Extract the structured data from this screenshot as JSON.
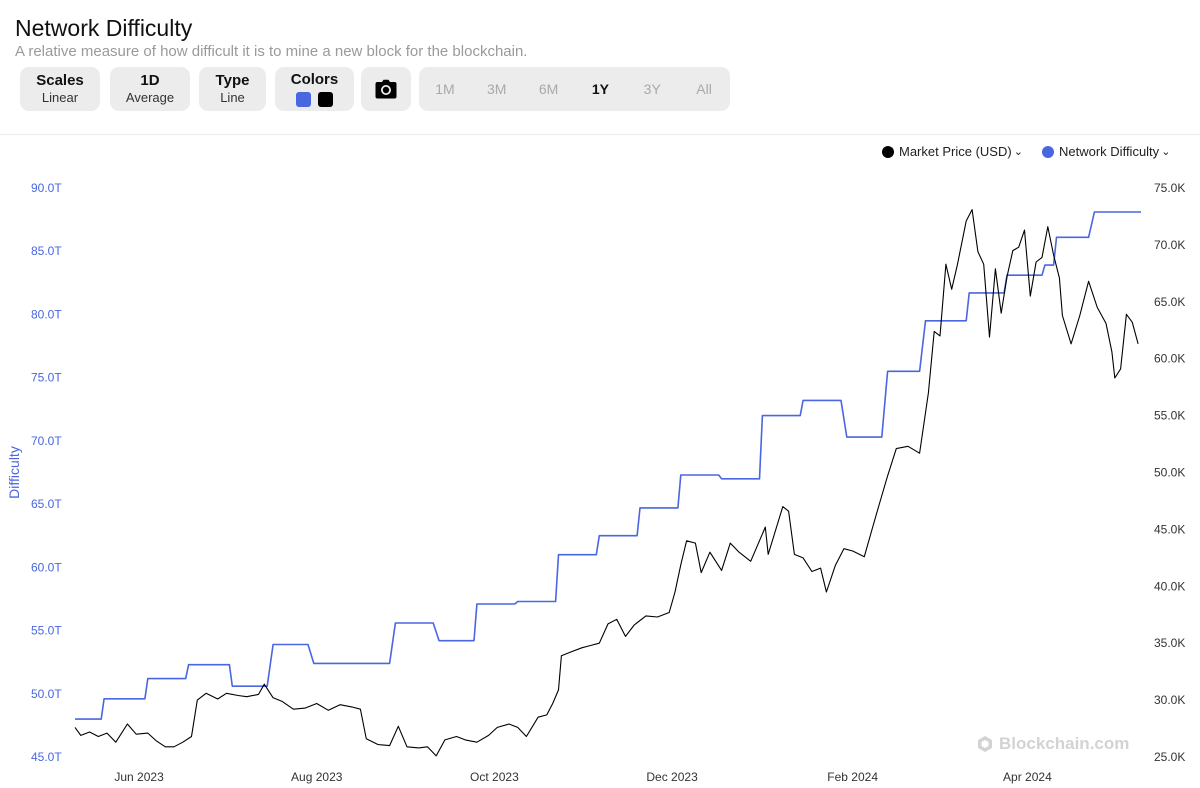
{
  "header": {
    "title": "Network Difficulty",
    "subtitle": "A relative measure of how difficult it is to mine a new block for the blockchain."
  },
  "controls": {
    "scales": {
      "label": "Scales",
      "value": "Linear"
    },
    "average": {
      "label": "1D",
      "value": "Average"
    },
    "type": {
      "label": "Type",
      "value": "Line"
    },
    "colors": {
      "label": "Colors",
      "swatch1": "#4a66e0",
      "swatch2": "#000000"
    },
    "camera_icon": "camera-icon"
  },
  "ranges": [
    {
      "label": "1M",
      "active": false
    },
    {
      "label": "3M",
      "active": false
    },
    {
      "label": "6M",
      "active": false
    },
    {
      "label": "1Y",
      "active": true
    },
    {
      "label": "3Y",
      "active": false
    },
    {
      "label": "All",
      "active": false
    }
  ],
  "legend": {
    "price": "Market Price (USD)",
    "difficulty": "Network Difficulty"
  },
  "watermark": "Blockchain.com",
  "chart_data": {
    "type": "line",
    "ylabel_left": "Difficulty",
    "x_ticks": [
      "Jun 2023",
      "Aug 2023",
      "Oct 2023",
      "Dec 2023",
      "Feb 2024",
      "Apr 2024"
    ],
    "x_tick_dates": [
      "2023-06-01",
      "2023-08-01",
      "2023-10-01",
      "2023-12-01",
      "2024-02-01",
      "2024-04-01"
    ],
    "x_range": [
      "2023-05-10",
      "2024-05-10"
    ],
    "left_axis": {
      "min": 45,
      "max": 90,
      "unit": "T",
      "ticks": [
        "45.0T",
        "50.0T",
        "55.0T",
        "60.0T",
        "65.0T",
        "70.0T",
        "75.0T",
        "80.0T",
        "85.0T",
        "90.0T"
      ],
      "color": "#4a66e0"
    },
    "right_axis": {
      "min": 25,
      "max": 75,
      "unit": "K",
      "ticks": [
        "25.0K",
        "30.0K",
        "35.0K",
        "40.0K",
        "45.0K",
        "50.0K",
        "55.0K",
        "60.0K",
        "65.0K",
        "70.0K",
        "75.0K"
      ]
    },
    "series": [
      {
        "name": "Network Difficulty",
        "axis": "left",
        "color": "#4a66e0",
        "points": [
          [
            "2023-05-10",
            48.0
          ],
          [
            "2023-05-19",
            48.0
          ],
          [
            "2023-05-20",
            49.6
          ],
          [
            "2023-06-03",
            49.6
          ],
          [
            "2023-06-04",
            51.2
          ],
          [
            "2023-06-17",
            51.2
          ],
          [
            "2023-06-18",
            52.3
          ],
          [
            "2023-07-02",
            52.3
          ],
          [
            "2023-07-03",
            50.6
          ],
          [
            "2023-07-15",
            50.6
          ],
          [
            "2023-07-17",
            53.9
          ],
          [
            "2023-07-29",
            53.9
          ],
          [
            "2023-07-31",
            52.4
          ],
          [
            "2023-08-26",
            52.4
          ],
          [
            "2023-08-28",
            55.6
          ],
          [
            "2023-09-10",
            55.6
          ],
          [
            "2023-09-12",
            54.2
          ],
          [
            "2023-09-24",
            54.2
          ],
          [
            "2023-09-25",
            57.1
          ],
          [
            "2023-10-08",
            57.1
          ],
          [
            "2023-10-09",
            57.3
          ],
          [
            "2023-10-22",
            57.3
          ],
          [
            "2023-10-23",
            61.0
          ],
          [
            "2023-11-05",
            61.0
          ],
          [
            "2023-11-06",
            62.5
          ],
          [
            "2023-11-19",
            62.5
          ],
          [
            "2023-11-20",
            64.7
          ],
          [
            "2023-12-03",
            64.7
          ],
          [
            "2023-12-04",
            67.3
          ],
          [
            "2023-12-17",
            67.3
          ],
          [
            "2023-12-18",
            67.0
          ],
          [
            "2023-12-31",
            67.0
          ],
          [
            "2024-01-01",
            72.0
          ],
          [
            "2024-01-14",
            72.0
          ],
          [
            "2024-01-15",
            73.2
          ],
          [
            "2024-01-28",
            73.2
          ],
          [
            "2024-01-30",
            70.3
          ],
          [
            "2024-02-11",
            70.3
          ],
          [
            "2024-02-13",
            75.5
          ],
          [
            "2024-02-24",
            75.5
          ],
          [
            "2024-02-26",
            79.5
          ],
          [
            "2024-03-09",
            79.5
          ],
          [
            "2024-03-11",
            79.5
          ],
          [
            "2024-03-12",
            81.7
          ],
          [
            "2024-03-24",
            81.7
          ],
          [
            "2024-03-25",
            83.1
          ],
          [
            "2024-04-05",
            83.1
          ],
          [
            "2024-04-06",
            83.1
          ],
          [
            "2024-04-07",
            83.9
          ],
          [
            "2024-04-10",
            83.9
          ],
          [
            "2024-04-11",
            86.1
          ],
          [
            "2024-04-22",
            86.1
          ],
          [
            "2024-04-24",
            88.1
          ],
          [
            "2024-05-10",
            88.1
          ]
        ]
      },
      {
        "name": "Market Price (USD)",
        "axis": "right",
        "color": "#000000",
        "points": [
          [
            "2023-05-10",
            27.6
          ],
          [
            "2023-05-12",
            26.9
          ],
          [
            "2023-05-15",
            27.2
          ],
          [
            "2023-05-18",
            26.8
          ],
          [
            "2023-05-21",
            27.1
          ],
          [
            "2023-05-24",
            26.3
          ],
          [
            "2023-05-28",
            27.9
          ],
          [
            "2023-05-31",
            27.0
          ],
          [
            "2023-06-04",
            27.1
          ],
          [
            "2023-06-07",
            26.4
          ],
          [
            "2023-06-10",
            25.9
          ],
          [
            "2023-06-13",
            25.9
          ],
          [
            "2023-06-16",
            26.3
          ],
          [
            "2023-06-19",
            26.8
          ],
          [
            "2023-06-21",
            30.0
          ],
          [
            "2023-06-24",
            30.6
          ],
          [
            "2023-06-28",
            30.1
          ],
          [
            "2023-07-01",
            30.6
          ],
          [
            "2023-07-05",
            30.4
          ],
          [
            "2023-07-08",
            30.3
          ],
          [
            "2023-07-12",
            30.5
          ],
          [
            "2023-07-14",
            31.4
          ],
          [
            "2023-07-17",
            30.2
          ],
          [
            "2023-07-20",
            29.9
          ],
          [
            "2023-07-24",
            29.2
          ],
          [
            "2023-07-28",
            29.3
          ],
          [
            "2023-08-01",
            29.7
          ],
          [
            "2023-08-05",
            29.1
          ],
          [
            "2023-08-09",
            29.6
          ],
          [
            "2023-08-13",
            29.4
          ],
          [
            "2023-08-16",
            29.2
          ],
          [
            "2023-08-18",
            26.6
          ],
          [
            "2023-08-22",
            26.1
          ],
          [
            "2023-08-26",
            26.0
          ],
          [
            "2023-08-29",
            27.7
          ],
          [
            "2023-09-01",
            25.9
          ],
          [
            "2023-09-05",
            25.8
          ],
          [
            "2023-09-08",
            25.9
          ],
          [
            "2023-09-11",
            25.1
          ],
          [
            "2023-09-14",
            26.5
          ],
          [
            "2023-09-18",
            26.8
          ],
          [
            "2023-09-21",
            26.5
          ],
          [
            "2023-09-25",
            26.3
          ],
          [
            "2023-09-29",
            26.9
          ],
          [
            "2023-10-02",
            27.6
          ],
          [
            "2023-10-06",
            27.9
          ],
          [
            "2023-10-09",
            27.6
          ],
          [
            "2023-10-12",
            26.8
          ],
          [
            "2023-10-16",
            28.5
          ],
          [
            "2023-10-19",
            28.7
          ],
          [
            "2023-10-21",
            29.7
          ],
          [
            "2023-10-23",
            30.9
          ],
          [
            "2023-10-24",
            33.9
          ],
          [
            "2023-10-27",
            34.2
          ],
          [
            "2023-10-31",
            34.6
          ],
          [
            "2023-11-03",
            34.8
          ],
          [
            "2023-11-06",
            35.0
          ],
          [
            "2023-11-09",
            36.7
          ],
          [
            "2023-11-12",
            37.1
          ],
          [
            "2023-11-15",
            35.6
          ],
          [
            "2023-11-18",
            36.6
          ],
          [
            "2023-11-22",
            37.4
          ],
          [
            "2023-11-26",
            37.3
          ],
          [
            "2023-11-30",
            37.7
          ],
          [
            "2023-12-02",
            39.5
          ],
          [
            "2023-12-04",
            41.9
          ],
          [
            "2023-12-06",
            44.0
          ],
          [
            "2023-12-09",
            43.8
          ],
          [
            "2023-12-11",
            41.2
          ],
          [
            "2023-12-14",
            43.0
          ],
          [
            "2023-12-18",
            41.4
          ],
          [
            "2023-12-21",
            43.8
          ],
          [
            "2023-12-24",
            43.0
          ],
          [
            "2023-12-28",
            42.2
          ],
          [
            "2024-01-02",
            45.2
          ],
          [
            "2024-01-03",
            42.8
          ],
          [
            "2024-01-08",
            47.0
          ],
          [
            "2024-01-10",
            46.6
          ],
          [
            "2024-01-12",
            42.8
          ],
          [
            "2024-01-15",
            42.5
          ],
          [
            "2024-01-18",
            41.3
          ],
          [
            "2024-01-21",
            41.6
          ],
          [
            "2024-01-23",
            39.5
          ],
          [
            "2024-01-26",
            41.8
          ],
          [
            "2024-01-29",
            43.3
          ],
          [
            "2024-02-01",
            43.1
          ],
          [
            "2024-02-05",
            42.6
          ],
          [
            "2024-02-08",
            45.3
          ],
          [
            "2024-02-10",
            47.1
          ],
          [
            "2024-02-13",
            49.7
          ],
          [
            "2024-02-16",
            52.1
          ],
          [
            "2024-02-20",
            52.3
          ],
          [
            "2024-02-24",
            51.7
          ],
          [
            "2024-02-27",
            57.0
          ],
          [
            "2024-02-29",
            62.4
          ],
          [
            "2024-03-02",
            62.0
          ],
          [
            "2024-03-04",
            68.3
          ],
          [
            "2024-03-06",
            66.1
          ],
          [
            "2024-03-08",
            68.3
          ],
          [
            "2024-03-11",
            72.1
          ],
          [
            "2024-03-13",
            73.1
          ],
          [
            "2024-03-15",
            69.4
          ],
          [
            "2024-03-17",
            68.3
          ],
          [
            "2024-03-19",
            61.9
          ],
          [
            "2024-03-21",
            67.9
          ],
          [
            "2024-03-23",
            64.0
          ],
          [
            "2024-03-25",
            67.2
          ],
          [
            "2024-03-27",
            69.5
          ],
          [
            "2024-03-29",
            69.8
          ],
          [
            "2024-03-31",
            71.3
          ],
          [
            "2024-04-02",
            65.5
          ],
          [
            "2024-04-04",
            68.5
          ],
          [
            "2024-04-06",
            68.9
          ],
          [
            "2024-04-08",
            71.6
          ],
          [
            "2024-04-10",
            69.1
          ],
          [
            "2024-04-12",
            67.1
          ],
          [
            "2024-04-13",
            63.8
          ],
          [
            "2024-04-16",
            61.3
          ],
          [
            "2024-04-19",
            63.8
          ],
          [
            "2024-04-22",
            66.8
          ],
          [
            "2024-04-25",
            64.5
          ],
          [
            "2024-04-28",
            63.1
          ],
          [
            "2024-04-30",
            60.6
          ],
          [
            "2024-05-01",
            58.3
          ],
          [
            "2024-05-03",
            59.1
          ],
          [
            "2024-05-05",
            63.9
          ],
          [
            "2024-05-07",
            63.2
          ],
          [
            "2024-05-09",
            61.3
          ]
        ]
      }
    ]
  }
}
